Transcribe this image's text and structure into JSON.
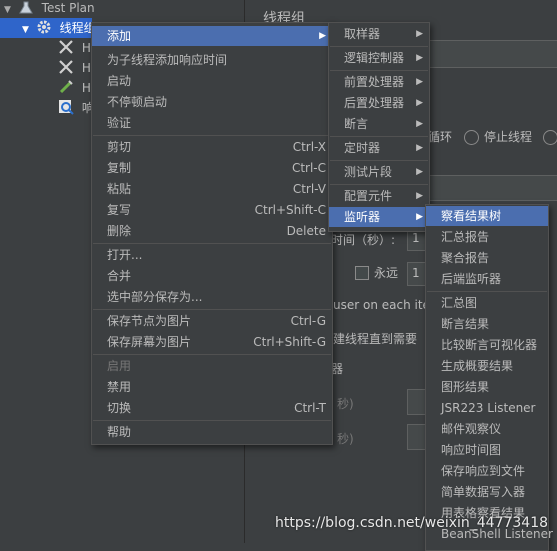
{
  "tree": {
    "root": "Test Plan",
    "thread_group": "线程组",
    "children_prefix": [
      "H",
      "H",
      "H",
      "响"
    ]
  },
  "right_panel": {
    "title": "线程组",
    "loop_label": "循环",
    "stop_thread": "停止线程",
    "ramp_time_label": "时间（秒）:",
    "ramp_time_value": "1",
    "forever_label": "永远",
    "loop_value": "1",
    "same_user": "user on each itera",
    "delay_create": "建线程直到需要",
    "fragment1": "器",
    "fragment2": "秒)",
    "fragment3": "秒)"
  },
  "context_menu": {
    "items": [
      {
        "label": "添加",
        "shortcut": "",
        "submenu": true,
        "highlighted": true
      },
      {
        "label": "为子线程添加响应时间",
        "shortcut": ""
      },
      {
        "label": "启动",
        "shortcut": ""
      },
      {
        "label": "不停顿启动",
        "shortcut": ""
      },
      {
        "label": "验证",
        "shortcut": ""
      },
      {
        "label": "剪切",
        "shortcut": "Ctrl-X"
      },
      {
        "label": "复制",
        "shortcut": "Ctrl-C"
      },
      {
        "label": "粘贴",
        "shortcut": "Ctrl-V"
      },
      {
        "label": "复写",
        "shortcut": "Ctrl+Shift-C"
      },
      {
        "label": "删除",
        "shortcut": "Delete"
      },
      {
        "label": "打开...",
        "shortcut": ""
      },
      {
        "label": "合并",
        "shortcut": ""
      },
      {
        "label": "选中部分保存为...",
        "shortcut": ""
      },
      {
        "label": "保存节点为图片",
        "shortcut": "Ctrl-G"
      },
      {
        "label": "保存屏幕为图片",
        "shortcut": "Ctrl+Shift-G"
      },
      {
        "label": "启用",
        "shortcut": "",
        "disabled": true
      },
      {
        "label": "禁用",
        "shortcut": ""
      },
      {
        "label": "切换",
        "shortcut": "Ctrl-T"
      },
      {
        "label": "帮助",
        "shortcut": ""
      }
    ]
  },
  "add_submenu": {
    "items": [
      {
        "label": "取样器"
      },
      {
        "label": "逻辑控制器"
      },
      {
        "label": "前置处理器"
      },
      {
        "label": "后置处理器"
      },
      {
        "label": "断言"
      },
      {
        "label": "定时器"
      },
      {
        "label": "测试片段"
      },
      {
        "label": "配置元件"
      },
      {
        "label": "监听器",
        "highlighted": true
      }
    ]
  },
  "listener_submenu": {
    "items": [
      {
        "label": "察看结果树",
        "highlighted": true
      },
      {
        "label": "汇总报告"
      },
      {
        "label": "聚合报告"
      },
      {
        "label": "后端监听器"
      },
      {
        "label": "汇总图"
      },
      {
        "label": "断言结果"
      },
      {
        "label": "比较断言可视化器"
      },
      {
        "label": "生成概要结果"
      },
      {
        "label": "图形结果"
      },
      {
        "label": "JSR223 Listener"
      },
      {
        "label": "邮件观察仪"
      },
      {
        "label": "响应时间图"
      },
      {
        "label": "保存响应到文件"
      },
      {
        "label": "简单数据写入器"
      },
      {
        "label": "用表格察看结果"
      },
      {
        "label": "BeanShell Listener"
      }
    ]
  },
  "watermark": "https://blog.csdn.net/weixin_44773418",
  "colors": {
    "background": "#3c3f41",
    "highlight": "#4b6eaf",
    "tree_selected": "#2f65ca",
    "text": "#bbbbbb"
  }
}
